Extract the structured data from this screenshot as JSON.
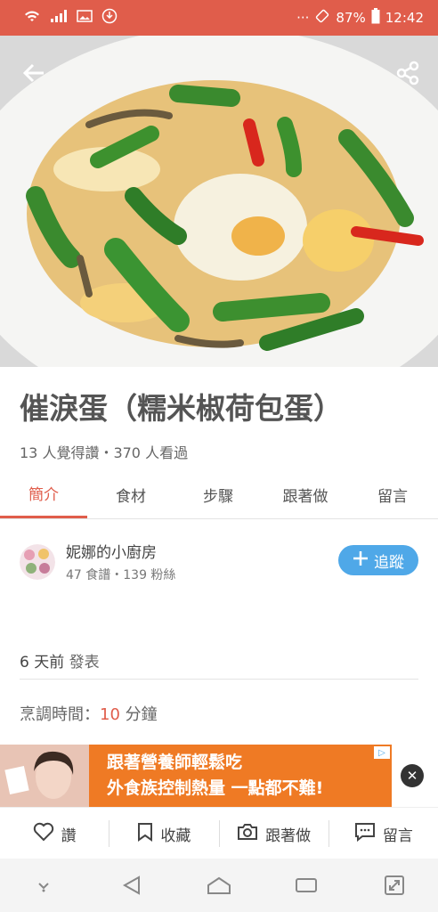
{
  "status_bar": {
    "battery": "87%",
    "time": "12:42",
    "more": "···",
    "icons": [
      "wifi-icon",
      "signal-icon",
      "image-icon",
      "download-icon",
      "vibrate-icon",
      "battery-icon"
    ]
  },
  "recipe": {
    "title": "催淚蛋（糯米椒荷包蛋）",
    "stats": "13 人覺得讚・370 人看過"
  },
  "tabs": [
    {
      "label": "簡介",
      "active": true
    },
    {
      "label": "食材"
    },
    {
      "label": "步驟"
    },
    {
      "label": "跟著做"
    },
    {
      "label": "留言"
    }
  ],
  "author": {
    "name": "妮娜的小廚房",
    "meta": "47 食譜・139 粉絲",
    "follow_label": "追蹤"
  },
  "posted": {
    "time": "6 天前",
    "suffix": " 發表"
  },
  "cook_time": {
    "label": "烹調時間：",
    "value": "10",
    "unit": " 分鐘"
  },
  "ad": {
    "line1": "跟著營養師輕鬆吃",
    "line2": "外食族控制熱量 一點都不難!"
  },
  "actions": {
    "like": "讚",
    "collect": "收藏",
    "follow_cook": "跟著做",
    "comment": "留言"
  },
  "colors": {
    "accent": "#e05d4b",
    "follow_button": "#4fa8e8",
    "ad_background": "#ef7a24"
  }
}
